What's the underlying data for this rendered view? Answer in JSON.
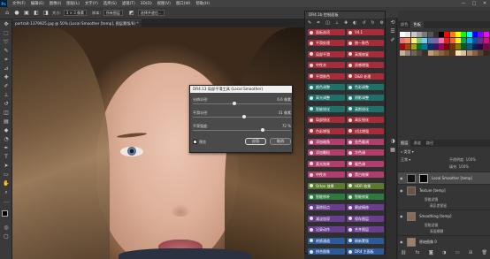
{
  "menubar": {
    "logo": "Ps",
    "items": [
      "文件(F)",
      "编辑(E)",
      "图像(I)",
      "图层(L)",
      "文字(Y)",
      "选择(S)",
      "滤镜(T)",
      "3D(D)",
      "视图(V)",
      "窗口(W)",
      "帮助(H)"
    ],
    "window_controls": [
      "—",
      "□",
      "✕"
    ]
  },
  "options": {
    "size_label": "大小:",
    "size_value": "3 × 3 像素",
    "sample_label": "样本:",
    "sample_value": "所有图层",
    "refine_label": "选择并遮住..."
  },
  "document": {
    "tab_title": "portrait-1379925.jpg @ 50% (Local Smoother [temp], 图层蒙版/8) *"
  },
  "dialog": {
    "title": "DR4.13 局部平滑工具 (Local Smoother)",
    "rows": [
      {
        "label": "分辨半径:",
        "value": "6.6 像素",
        "pos": 0.42
      },
      {
        "label": "平滑半径:",
        "value": "31 像素",
        "pos": 0.52
      },
      {
        "label": "平滑强度:",
        "value": "72 %",
        "pos": 0.72
      }
    ],
    "preview_label": "预览",
    "ok_label": "应用",
    "cancel_label": "取消"
  },
  "dr4": {
    "header": "DR4.1b 控制面板",
    "rows": [
      [
        {
          "t": "面板选项",
          "c": "red"
        },
        {
          "t": "V4.1",
          "c": "red"
        }
      ],
      [
        {
          "t": "平滑处理",
          "c": "red"
        },
        {
          "t": "统一肤色",
          "c": "red"
        }
      ],
      [
        {
          "t": "局部平滑",
          "c": "red"
        },
        {
          "t": "高频修复",
          "c": "red"
        }
      ],
      [
        {
          "t": "中性灰",
          "c": "red"
        },
        {
          "t": "质感增强",
          "c": "red"
        }
      ],
      [
        {
          "t": "平滑肤色",
          "c": "red"
        },
        {
          "t": "D&B 处理",
          "c": "red"
        }
      ],
      [
        {
          "t": "颜色调整",
          "c": "teal"
        },
        {
          "t": "色彩调整",
          "c": "teal"
        }
      ],
      [
        {
          "t": "高光调整",
          "c": "teal"
        },
        {
          "t": "阴影调整",
          "c": "teal"
        }
      ],
      [
        {
          "t": "智能锐化",
          "c": "teal"
        },
        {
          "t": "高斯锐化",
          "c": "teal"
        }
      ],
      [
        {
          "t": "局部锐化",
          "c": "red"
        },
        {
          "t": "高反锐化",
          "c": "red"
        }
      ],
      [
        {
          "t": "色彩增强",
          "c": "red"
        },
        {
          "t": "对比增强",
          "c": "red"
        }
      ],
      [
        {
          "t": "添加暗角",
          "c": "pink"
        },
        {
          "t": "金色暖调",
          "c": "pink"
        }
      ],
      [
        {
          "t": "添加颗粒",
          "c": "pink"
        },
        {
          "t": "冷色调",
          "c": "pink"
        }
      ],
      [
        {
          "t": "柔光效果",
          "c": "pink"
        },
        {
          "t": "暖色调",
          "c": "pink"
        }
      ],
      [
        {
          "t": "中性灰",
          "c": "pink"
        },
        {
          "t": "黑白效果",
          "c": "pink"
        }
      ],
      [
        {
          "t": "Orton 效果",
          "c": "olive"
        },
        {
          "t": "HDR 效果",
          "c": "olive"
        }
      ],
      [
        {
          "t": "智能修补",
          "c": "green"
        },
        {
          "t": "智能修复",
          "c": "green"
        }
      ],
      [
        {
          "t": "清除斑点",
          "c": "purple"
        },
        {
          "t": "磨皮精修",
          "c": "purple"
        }
      ],
      [
        {
          "t": "减淡加深",
          "c": "purple"
        },
        {
          "t": "保存图层",
          "c": "purple"
        }
      ],
      [
        {
          "t": "记录动作",
          "c": "purple"
        },
        {
          "t": "合并图层",
          "c": "purple"
        }
      ],
      [
        {
          "t": "转换通道",
          "c": "blue"
        },
        {
          "t": "刷新蒙版",
          "c": "blue"
        }
      ],
      [
        {
          "t": "拼合图像",
          "c": "blue"
        },
        {
          "t": "DR4 主面板",
          "c": "blue"
        }
      ]
    ]
  },
  "right": {
    "tabs": [
      "颜色",
      "色板"
    ],
    "layers_tabs": [
      "图层",
      "通道",
      "路径"
    ],
    "opacity_label": "不透明度: 100%",
    "fill_label": "填充: 100%",
    "layers": [
      {
        "name": "Local Smoother [temp]",
        "subs": []
      },
      {
        "name": "Texture [temp]",
        "subs": [
          "智能滤镜",
          "高反差保留"
        ]
      },
      {
        "name": "Smoothing [temp]",
        "subs": [
          "智能滤镜",
          "表面模糊"
        ]
      },
      {
        "name": "原始图像 0",
        "subs": []
      }
    ]
  },
  "colors": {
    "swatches": [
      "#ffffff",
      "#e6e6e6",
      "#c8c8c8",
      "#a0a0a0",
      "#7a7a7a",
      "#555555",
      "#303030",
      "#000000",
      "#ff0000",
      "#ff7f00",
      "#ffff00",
      "#00ff00",
      "#00ffff",
      "#0000ff",
      "#8000ff",
      "#ff00ff",
      "#f26d7d",
      "#f68e56",
      "#fff467",
      "#7cc576",
      "#6dcff6",
      "#5674b9",
      "#8560a8",
      "#f06eaa",
      "#ed1c24",
      "#f26522",
      "#fff200",
      "#00a651",
      "#00aeef",
      "#0054a6",
      "#662d91",
      "#ec008c",
      "#9e0b0f",
      "#a0410d",
      "#aba000",
      "#007236",
      "#0076a3",
      "#003471",
      "#440e62",
      "#9e005d",
      "#790000",
      "#7b2e00",
      "#827b00",
      "#005e20",
      "#005b7f",
      "#002157",
      "#32004b",
      "#7b0046",
      "#c7b299",
      "#998675",
      "#736357",
      "#534741",
      "#37302a",
      "#c69c6d",
      "#a67c52",
      "#8c6239",
      "#754c24",
      "#603913",
      "#f5e0c0",
      "#e0c09a",
      "#b08a6a",
      "#8a6246",
      "#5e3f2a",
      "#3a2618"
    ]
  }
}
